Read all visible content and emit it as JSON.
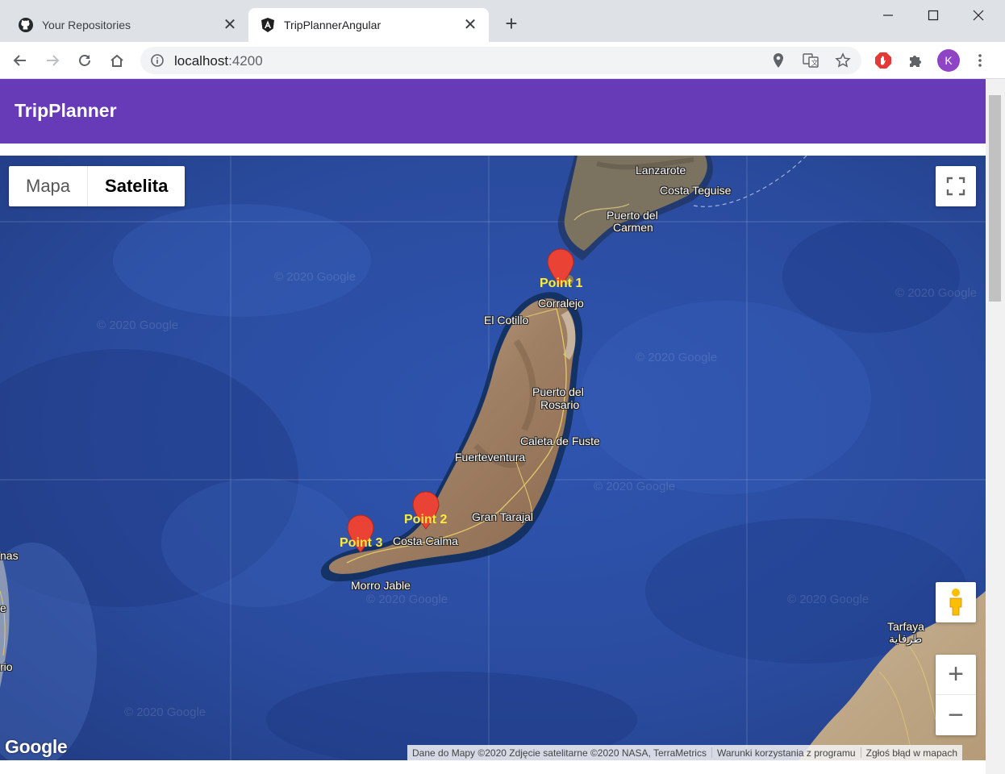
{
  "browser": {
    "tabs": [
      {
        "title": "Your Repositories",
        "icon": "github-icon",
        "active": false
      },
      {
        "title": "TripPlannerAngular",
        "icon": "angular-icon",
        "active": true
      }
    ],
    "url_host": "localhost",
    "url_port": ":4200",
    "profile_initial": "K"
  },
  "app": {
    "title": "TripPlanner",
    "accent": "#673ab7"
  },
  "map": {
    "type_options": [
      "Mapa",
      "Satelita"
    ],
    "selected_type": "Satelita",
    "places": {
      "lanzarote": "Lanzarote",
      "costa_teguise": "Costa Teguise",
      "puerto_carmen_1": "Puerto del",
      "puerto_carmen_2": "Carmen",
      "corralejo": "Corralejo",
      "el_cotillo": "El Cotillo",
      "puerto_rosario_1": "Puerto del",
      "puerto_rosario_2": "Rosario",
      "caleta": "Caleta de Fuste",
      "fuerteventura": "Fuerteventura",
      "gran_tarajal": "Gran Tarajal",
      "costa_calma": "Costa Calma",
      "morro_jable": "Morro Jable",
      "tarfaya": "Tarfaya",
      "tarfaya_ar": "طرفاية",
      "left_nas": "nas",
      "left_e": "e",
      "left_rio": "rio"
    },
    "markers": [
      {
        "label": "Point 1",
        "color": "#ea4335"
      },
      {
        "label": "Point 2",
        "color": "#ea4335"
      },
      {
        "label": "Point 3",
        "color": "#ea4335"
      }
    ],
    "watermark": "© 2020 Google",
    "logo": "Google",
    "attribution": {
      "data": "Dane do Mapy ©2020 Zdjęcie satelitarne ©2020 NASA, TerraMetrics",
      "terms": "Warunki korzystania z programu",
      "report": "Zgłoś błąd w mapach"
    },
    "zoom_in": "+",
    "zoom_out": "−"
  }
}
